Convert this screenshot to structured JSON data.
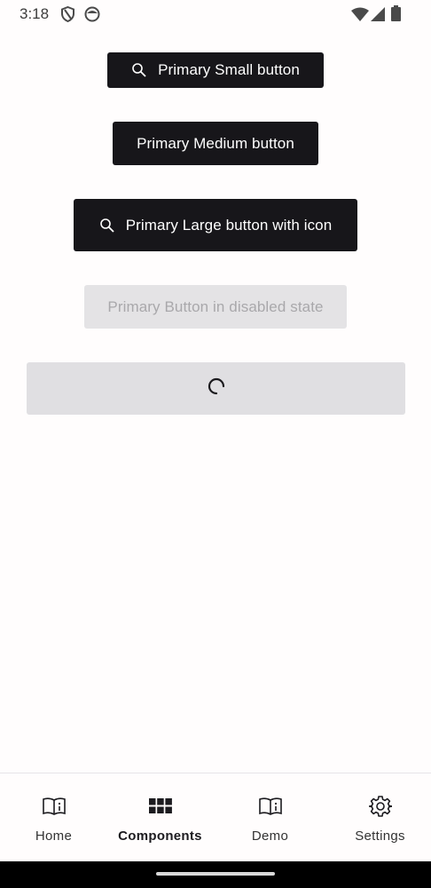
{
  "status_bar": {
    "time": "3:18",
    "left_icons": [
      "shield-icon",
      "face-icon"
    ],
    "right_icons": [
      "wifi-icon",
      "signal-icon",
      "battery-icon"
    ]
  },
  "buttons": {
    "small": {
      "label": "Primary Small button",
      "icon": "search-icon"
    },
    "medium": {
      "label": "Primary Medium button"
    },
    "large": {
      "label": "Primary Large button with icon",
      "icon": "search-icon"
    },
    "disabled": {
      "label": "Primary Button in disabled state"
    },
    "loading": {
      "icon": "loading-spinner-icon"
    }
  },
  "colors": {
    "primary": "#17161a",
    "on_primary": "#ffffff",
    "disabled_bg": "#e4e3e5",
    "disabled_text": "#a9a8ab",
    "loading_bg": "#e0dfe2"
  },
  "bottom_nav": {
    "items": [
      {
        "label": "Home",
        "icon": "book-info-icon",
        "active": false
      },
      {
        "label": "Components",
        "icon": "grid-icon",
        "active": true
      },
      {
        "label": "Demo",
        "icon": "book-info-icon",
        "active": false
      },
      {
        "label": "Settings",
        "icon": "gear-icon",
        "active": false
      }
    ]
  }
}
